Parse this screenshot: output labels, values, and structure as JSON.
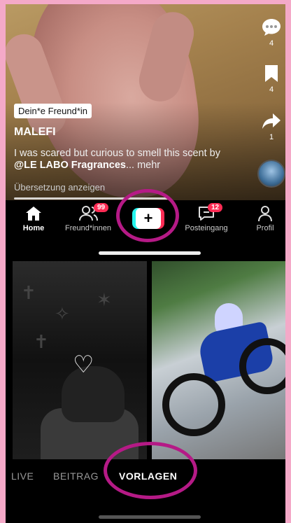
{
  "video": {
    "badge": "Dein*e Freund*in",
    "username": "MALEFI",
    "caption_pre": "I was scared but curious to smell this scent by ",
    "caption_mention": "@LE LABO Fragrances",
    "caption_post": "... mehr",
    "translate": "Übersetzung anzeigen",
    "progress": 0.55
  },
  "side_actions": {
    "comments": {
      "icon": "comment-icon",
      "count": "4"
    },
    "saves": {
      "icon": "bookmark-icon",
      "count": "4"
    },
    "shares": {
      "icon": "share-icon",
      "count": "1"
    }
  },
  "nav": {
    "home": "Home",
    "friends": "Freund*innen",
    "friends_badge": "99",
    "create": "+",
    "inbox": "Posteingang",
    "inbox_badge": "12",
    "profile": "Profil"
  },
  "tabs": {
    "live": "LIVE",
    "post": "BEITRAG",
    "templates": "VORLAGEN"
  },
  "colors": {
    "frame": "#f4a9c8",
    "highlight_ring": "#b51a86",
    "badge": "#fe2c55",
    "accent_cyan": "#25f4ee"
  }
}
